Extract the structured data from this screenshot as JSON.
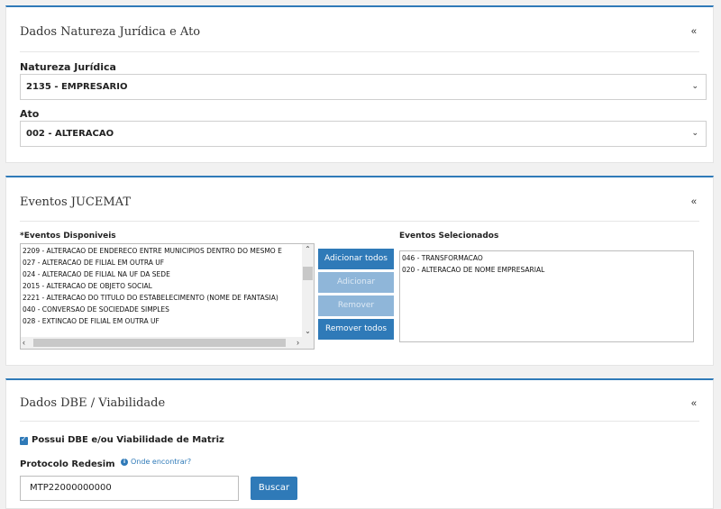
{
  "natureza": {
    "title": "Dados Natureza Jurídica e Ato",
    "collapse": "«",
    "natureza_label": "Natureza Jurídica",
    "natureza_value": "2135 - EMPRESARIO",
    "ato_label": "Ato",
    "ato_value": "002 - ALTERACAO"
  },
  "eventos": {
    "title": "Eventos JUCEMAT",
    "collapse": "«",
    "disponiveis_label": "*Eventos Disponiveis",
    "selecionados_label": "Eventos Selecionados",
    "disponiveis": [
      "2209 - ALTERACAO DE ENDERECO ENTRE MUNICIPIOS DENTRO DO MESMO E",
      "027 - ALTERACAO DE FILIAL EM OUTRA UF",
      "024 - ALTERACAO DE FILIAL NA UF DA SEDE",
      "2015 - ALTERACAO DE OBJETO SOCIAL",
      "2221 - ALTERACAO DO TITULO DO ESTABELECIMENTO (NOME DE FANTASIA)",
      "040 - CONVERSAO DE SOCIEDADE SIMPLES",
      "028 - EXTINCAO DE FILIAL EM OUTRA UF"
    ],
    "selecionados": [
      "046 - TRANSFORMACAO",
      "020 - ALTERACAO DE NOME EMPRESARIAL"
    ],
    "btn_add_all": "Adicionar todos",
    "btn_add": "Adicionar",
    "btn_remove": "Remover",
    "btn_remove_all": "Remover todos"
  },
  "dbe": {
    "title": "Dados DBE / Viabilidade",
    "collapse": "«",
    "checkbox_label": "Possui DBE e/ou Viabilidade de Matriz",
    "checkbox_checked": true,
    "protocolo_label": "Protocolo Redesim",
    "help_link": "Onde encontrar?",
    "protocolo_value": "MTP22000000000",
    "search_button": "Buscar"
  },
  "colors": {
    "accent": "#2f7ab8",
    "disabled": "#8fb6d9"
  }
}
